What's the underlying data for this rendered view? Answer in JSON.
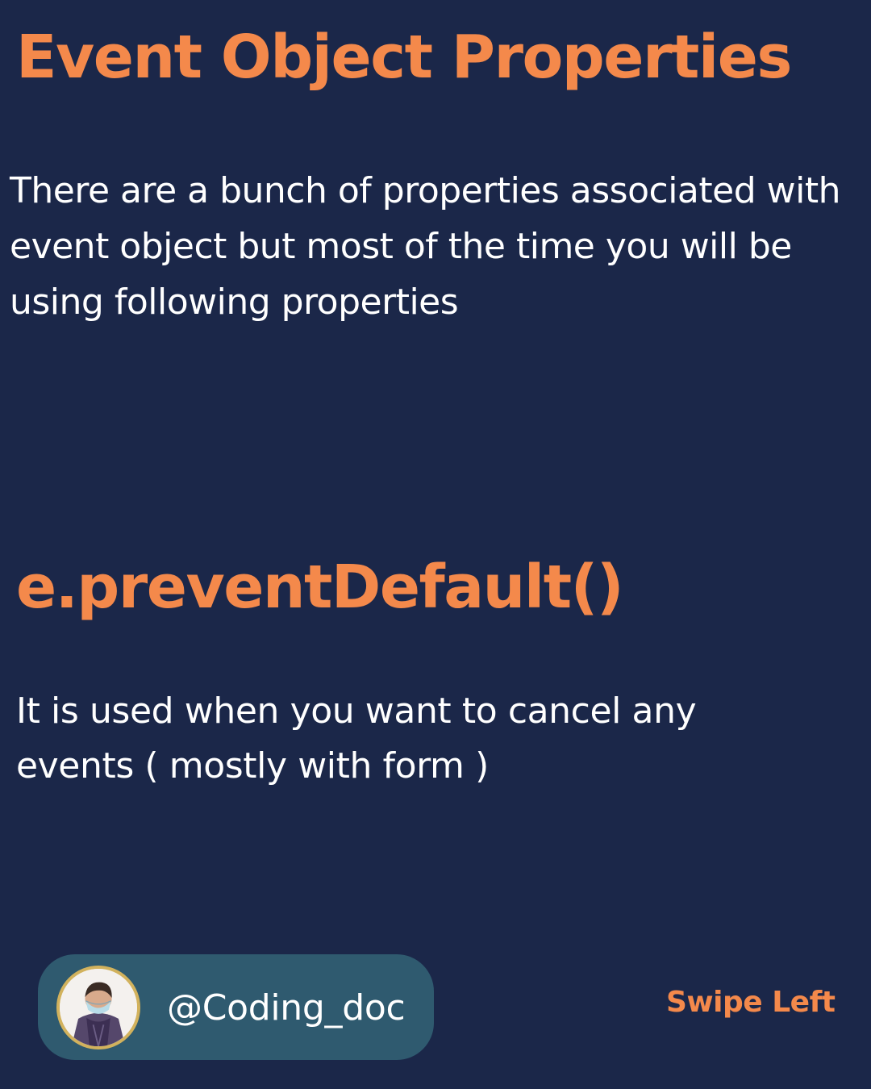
{
  "header": {
    "title": "Event Object Properties"
  },
  "intro": {
    "text": "There are a bunch of properties associated with event object but most of the time you will be using following properties"
  },
  "method": {
    "name": "e.preventDefault()",
    "description": "It is used when you want to cancel any events ( mostly with form )"
  },
  "profile": {
    "avatar_icon": "user-avatar-icon",
    "handle": "@Coding_doc"
  },
  "navigation": {
    "swipe_label": "Swipe Left"
  },
  "colors": {
    "background": "#1b2749",
    "accent": "#f4894b",
    "text": "#ffffff",
    "pill": "#2f5a6f",
    "avatar_ring": "#d2b25d"
  }
}
